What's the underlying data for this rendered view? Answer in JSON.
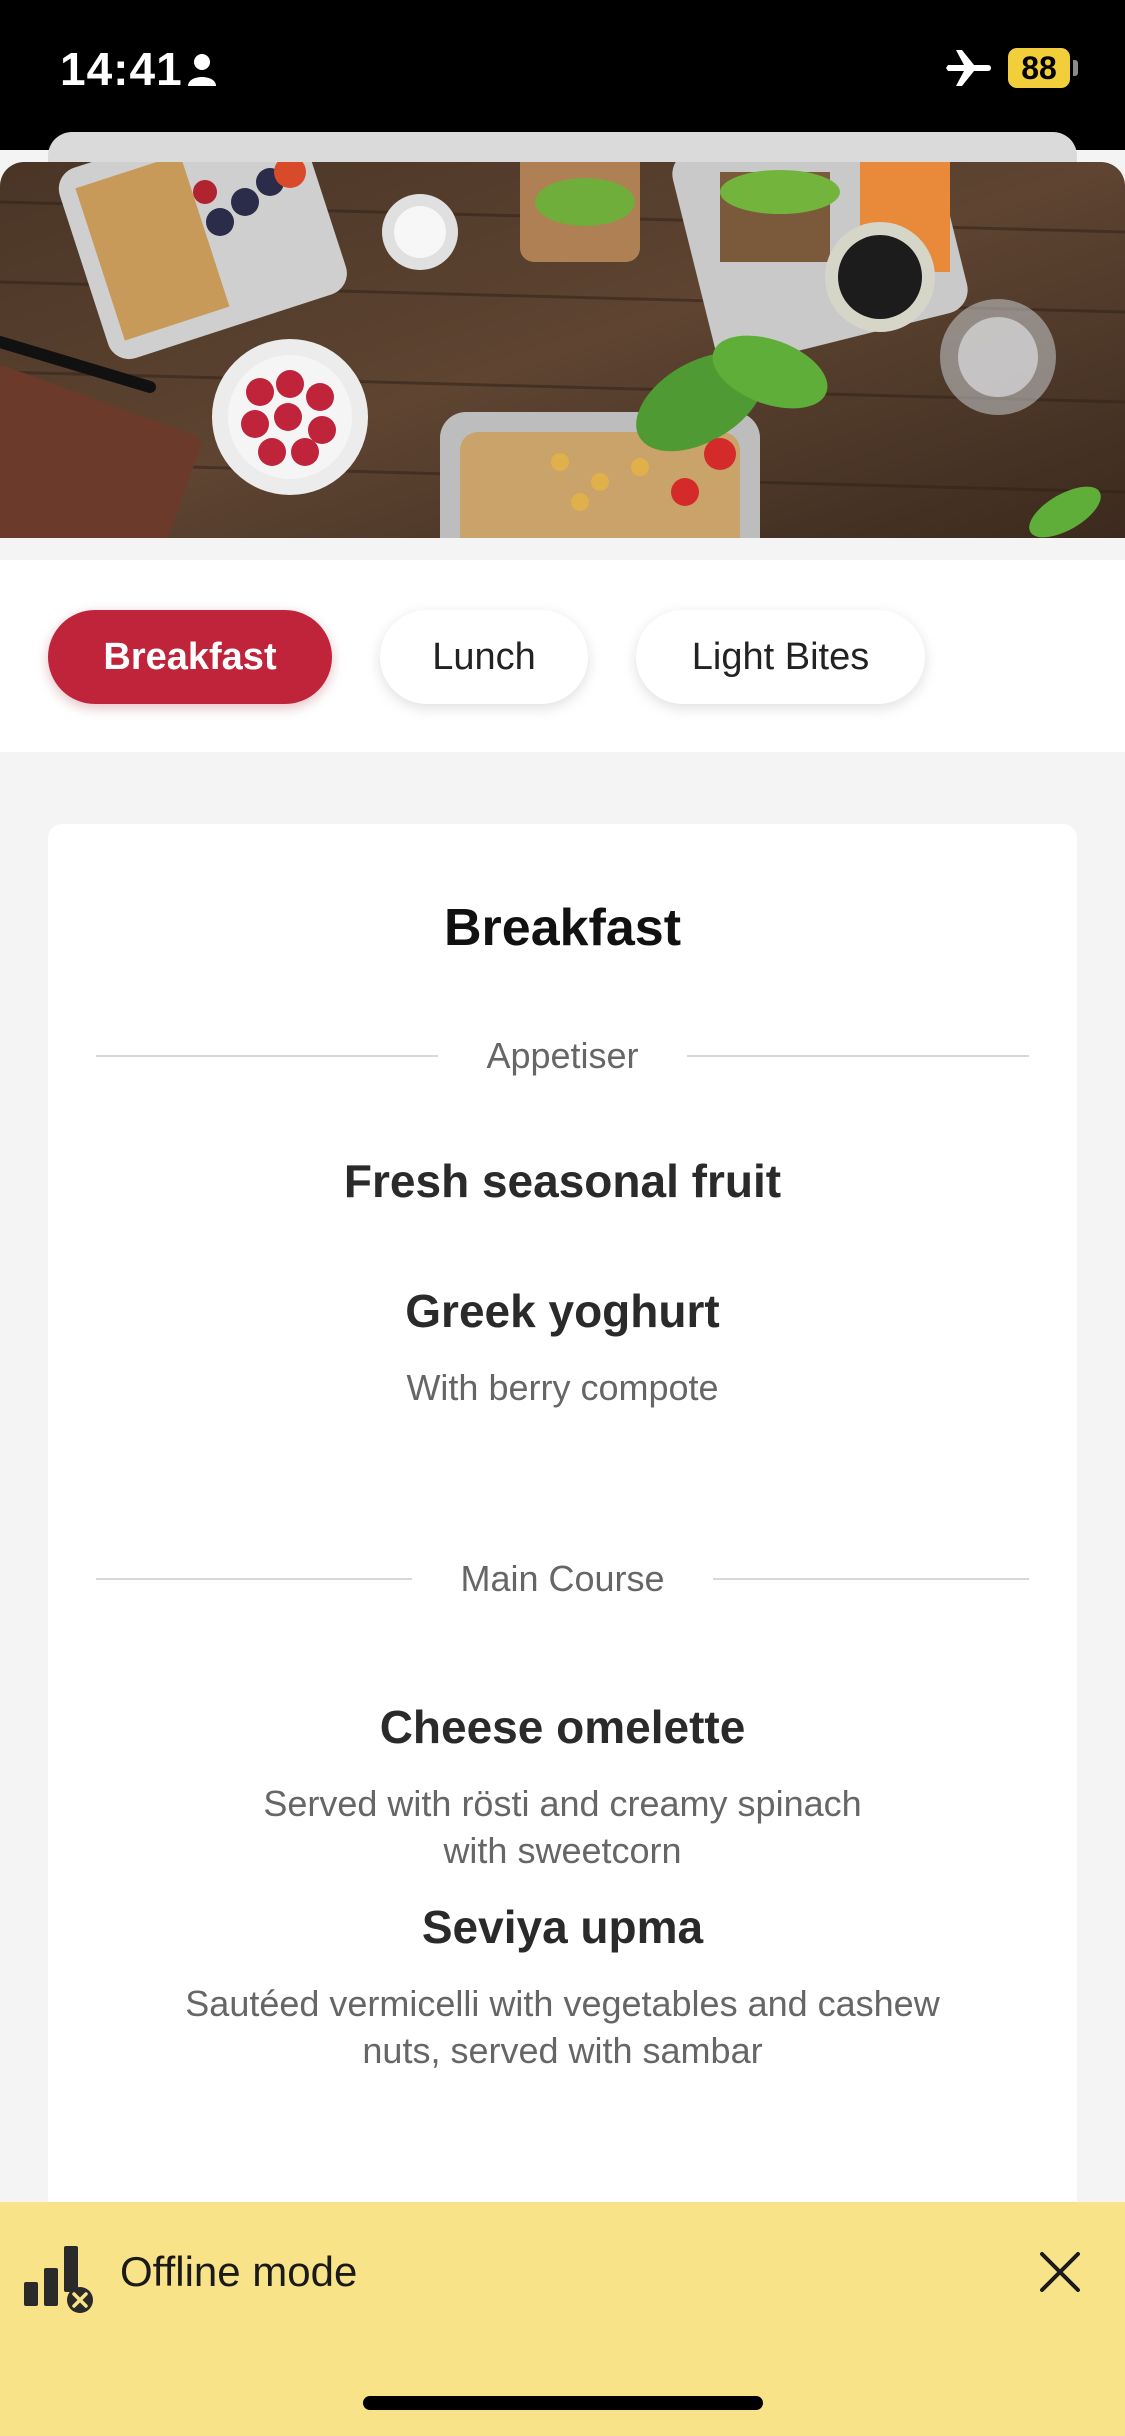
{
  "status_bar": {
    "time": "14:41",
    "battery": "88",
    "icons": [
      "person-icon",
      "airplane-icon",
      "battery-icon"
    ]
  },
  "tabs": [
    {
      "label": "Breakfast",
      "active": true
    },
    {
      "label": "Lunch",
      "active": false
    },
    {
      "label": "Light Bites",
      "active": false
    }
  ],
  "menu": {
    "title": "Breakfast",
    "sections": [
      {
        "label": "Appetiser",
        "dishes": [
          {
            "name": "Fresh seasonal fruit",
            "description": ""
          },
          {
            "name": "Greek yoghurt",
            "description": "With berry compote"
          }
        ]
      },
      {
        "label": "Main Course",
        "dishes": [
          {
            "name": "Cheese omelette",
            "description_lines": [
              "Served with rösti and creamy spinach",
              "with sweetcorn"
            ]
          },
          {
            "name": "Seviya upma",
            "description_lines": [
              "Sautéed vermicelli with vegetables and cashew",
              "nuts, served with sambar"
            ]
          }
        ]
      }
    ]
  },
  "offline_banner": {
    "label": "Offline mode",
    "icon": "offline-signal-icon",
    "close_icon": "close-icon"
  },
  "colors": {
    "accent": "#c0243a",
    "banner": "#f9e388",
    "battery": "#f2cf3a"
  }
}
